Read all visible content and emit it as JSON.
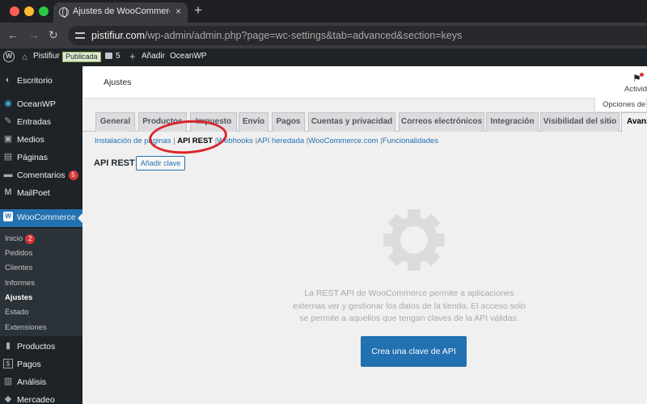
{
  "browser": {
    "tab_title": "Ajustes de WooCommerce ‹ P",
    "tab_close": "×",
    "new_tab": "+",
    "url_host": "pistifiur.com",
    "url_path": "/wp-admin/admin.php?page=wc-settings&tab=advanced&section=keys"
  },
  "admin_bar": {
    "wp_logo": "W",
    "site_name": "Pistifiur",
    "status_badge": "Publicada",
    "comment_count": "5",
    "add_new": "Añadir",
    "theme_link": "OceanWP"
  },
  "sidebar": {
    "items": [
      {
        "label": "Escritorio",
        "icon": "dashboard-icon",
        "glyph": "◐"
      },
      {
        "label": "OceanWP",
        "icon": "oceanwp-icon",
        "glyph": "◉"
      },
      {
        "label": "Entradas",
        "icon": "pin-icon",
        "glyph": "✎"
      },
      {
        "label": "Medios",
        "icon": "media-icon",
        "glyph": "▣"
      },
      {
        "label": "Páginas",
        "icon": "pages-icon",
        "glyph": "▤"
      },
      {
        "label": "Comentarios",
        "icon": "comments-icon",
        "glyph": "▬",
        "badge": "5"
      },
      {
        "label": "MailPoet",
        "icon": "mailpoet-icon",
        "glyph": "M"
      },
      {
        "label": "WooCommerce",
        "icon": "woocommerce-icon",
        "glyph": "W"
      },
      {
        "label": "Productos",
        "icon": "products-icon",
        "glyph": "▮"
      },
      {
        "label": "Pagos",
        "icon": "payments-icon",
        "glyph": "$"
      },
      {
        "label": "Análisis",
        "icon": "analytics-icon",
        "glyph": "▥"
      },
      {
        "label": "Mercadeo",
        "icon": "marketing-icon",
        "glyph": "◆"
      }
    ],
    "submenu": [
      {
        "label": "Inicio",
        "badge": "2"
      },
      {
        "label": "Pedidos"
      },
      {
        "label": "Clientes"
      },
      {
        "label": "Informes"
      },
      {
        "label": "Ajustes"
      },
      {
        "label": "Estado"
      },
      {
        "label": "Extensiones"
      }
    ]
  },
  "header": {
    "page_title": "Ajustes",
    "activity_label": "Actividad",
    "screen_options": "Opciones de pantalla"
  },
  "tabs": [
    "General",
    "Productos",
    "Impuesto",
    "Envío",
    "Pagos",
    "Cuentas y privacidad",
    "Correos electrónicos",
    "Integración",
    "Visibilidad del sitio",
    "Avanzado"
  ],
  "sections": [
    "Instalación de páginas",
    "API REST",
    "Webhooks",
    "API heredada",
    "WooCommerce.com",
    "Funcionalidades"
  ],
  "sections_separator": "|",
  "content": {
    "section_title": "API REST",
    "add_key_button": "Añadir clave",
    "blank_message": "La REST API de WooCommerce permite a aplicaciones externas ver y gestionar los datos de la tienda. El acceso solo se permite a aquellos que tengan claves de la API válidas.",
    "create_button": "Crea una clave de API"
  },
  "colors": {
    "accent": "#2271b1",
    "admin_dark": "#1d2327",
    "highlight_annotation": "#d9262b",
    "badge_red": "#d63638"
  }
}
